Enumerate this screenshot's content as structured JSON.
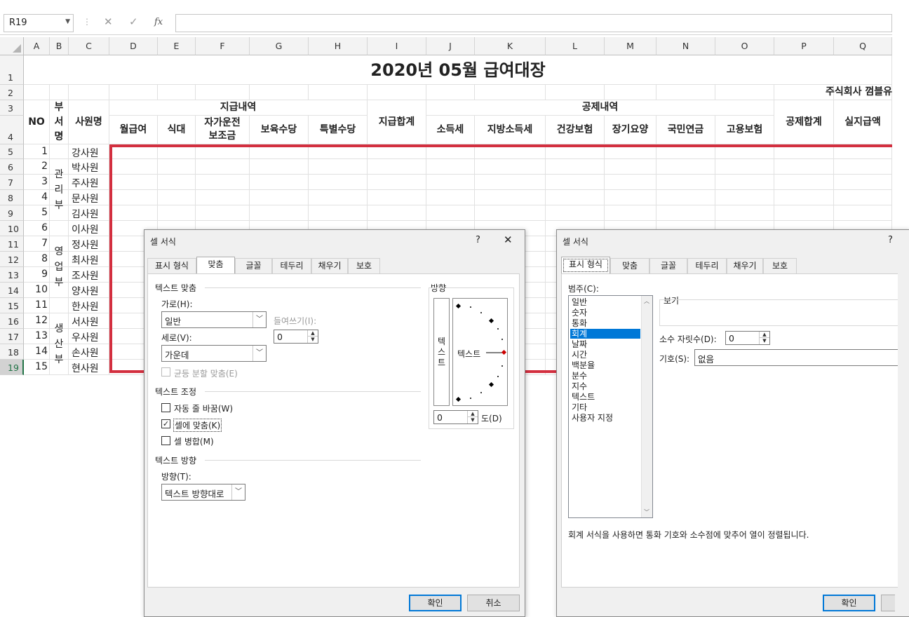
{
  "formula_bar": {
    "name_box": "R19",
    "cancel": "✕",
    "enter": "✓",
    "fx": "fx",
    "formula": ""
  },
  "columns": [
    "A",
    "B",
    "C",
    "D",
    "E",
    "F",
    "G",
    "H",
    "I",
    "J",
    "K",
    "L",
    "M",
    "N",
    "O",
    "P",
    "Q"
  ],
  "rows": [
    "1",
    "2",
    "3",
    "4",
    "5",
    "6",
    "7",
    "8",
    "9",
    "10",
    "11",
    "12",
    "13",
    "14",
    "15",
    "16",
    "17",
    "18",
    "19"
  ],
  "sheet": {
    "title": "2020년 05월 급여대장",
    "company": "주식회사 껌블유",
    "headers": {
      "no": "NO",
      "dept": "부서명",
      "name": "사원명",
      "pay_group": "지급내역",
      "monthly": "월급여",
      "meal": "식대",
      "car": "자가운전\n보조금",
      "childcare": "보육수당",
      "special": "특별수당",
      "pay_total": "지급합계",
      "deduct_group": "공제내역",
      "income_tax": "소득세",
      "local_tax": "지방소득세",
      "health": "건강보험",
      "longterm": "장기요양",
      "pension": "국민연금",
      "employment": "고용보험",
      "deduct_total": "공제합계",
      "net": "실지급액"
    },
    "departments": [
      {
        "label": "관\n리\n부",
        "rows": [
          2,
          4
        ]
      },
      {
        "label": "영\n업\n부",
        "rows": [
          7,
          9
        ]
      },
      {
        "label": "생\n산\n부",
        "rows": [
          12,
          14
        ]
      }
    ],
    "employees": [
      {
        "no": "1",
        "name": "강사원"
      },
      {
        "no": "2",
        "name": "박사원"
      },
      {
        "no": "3",
        "name": "주사원"
      },
      {
        "no": "4",
        "name": "문사원"
      },
      {
        "no": "5",
        "name": "김사원"
      },
      {
        "no": "6",
        "name": "이사원"
      },
      {
        "no": "7",
        "name": "정사원"
      },
      {
        "no": "8",
        "name": "최사원"
      },
      {
        "no": "9",
        "name": "조사원"
      },
      {
        "no": "10",
        "name": "양사원"
      },
      {
        "no": "11",
        "name": "한사원"
      },
      {
        "no": "12",
        "name": "서사원"
      },
      {
        "no": "13",
        "name": "우사원"
      },
      {
        "no": "14",
        "name": "손사원"
      },
      {
        "no": "15",
        "name": "현사원"
      }
    ]
  },
  "dialog1": {
    "title": "셀 서식",
    "help": "?",
    "close": "✕",
    "tabs": [
      "표시 형식",
      "맞춤",
      "글꼴",
      "테두리",
      "채우기",
      "보호"
    ],
    "active_tab": "맞춤",
    "text_align_group": "텍스트 맞춤",
    "horizontal_label": "가로(H):",
    "horizontal_value": "일반",
    "indent_label": "들여쓰기(I):",
    "indent_value": "0",
    "vertical_label": "세로(V):",
    "vertical_value": "가운데",
    "justify_distributed": "균등 분할 맞춤(E)",
    "text_control_group": "텍스트 조정",
    "wrap_text": "자동 줄 바꿈(W)",
    "shrink_to_fit": "셀에 맞춤(K)",
    "shrink_checked": true,
    "merge_cells": "셀 병합(M)",
    "direction_group": "텍스트 방향",
    "direction_label": "방향(T):",
    "direction_value": "텍스트 방향대로",
    "orientation_group": "방향",
    "vertical_text": "텍\n스\n트",
    "dial_text": "텍스트",
    "degree_value": "0",
    "degree_label": "도(D)",
    "ok": "확인",
    "cancel": "취소"
  },
  "dialog2": {
    "title": "셀 서식",
    "help": "?",
    "tabs": [
      "표시 형식",
      "맞춤",
      "글꼴",
      "테두리",
      "채우기",
      "보호"
    ],
    "active_tab": "표시 형식",
    "category_label": "범주(C):",
    "categories": [
      "일반",
      "숫자",
      "통화",
      "회계",
      "날짜",
      "시간",
      "백분율",
      "분수",
      "지수",
      "텍스트",
      "기타",
      "사용자 지정"
    ],
    "selected_category": "회계",
    "sample_label": "보기",
    "decimal_label": "소수 자릿수(D):",
    "decimal_value": "0",
    "symbol_label": "기호(S):",
    "symbol_value": "없음",
    "description": "회계 서식을 사용하면 통화 기호와 소수점에 맞추어 열이 정렬됩니다.",
    "ok": "확인"
  },
  "colors": {
    "highlight_border": "#d32f3f",
    "excel_green": "#217346",
    "selection_blue": "#0078d7"
  }
}
